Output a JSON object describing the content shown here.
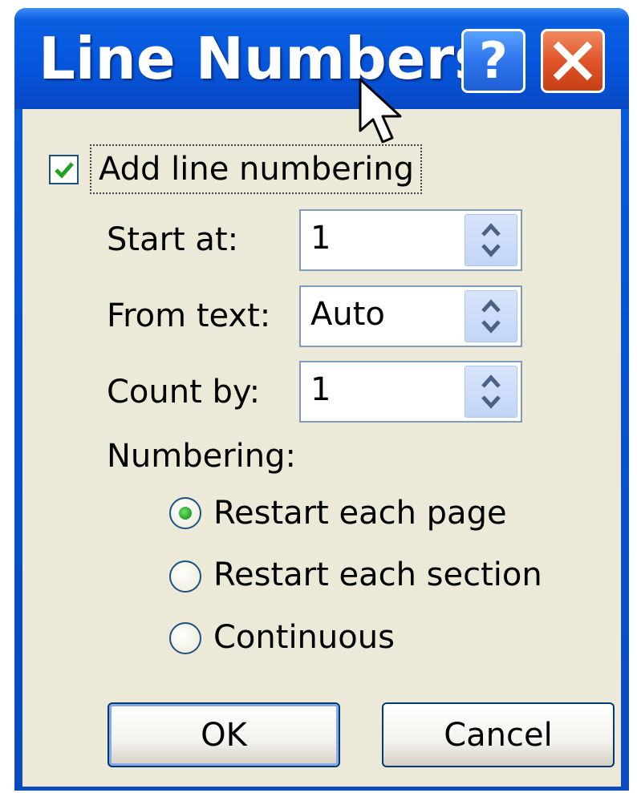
{
  "dialog": {
    "title": "Line Numbers",
    "help_button": "?",
    "close_icon": "close-icon"
  },
  "add_line_numbering": {
    "label": "Add line numbering",
    "checked": true
  },
  "fields": {
    "start_at": {
      "label": "Start at:",
      "value": "1"
    },
    "from_text": {
      "label": "From text:",
      "value": "Auto"
    },
    "count_by": {
      "label": "Count by:",
      "value": "1"
    }
  },
  "numbering": {
    "label": "Numbering:",
    "options": [
      {
        "label": "Restart each page",
        "selected": true
      },
      {
        "label": "Restart each section",
        "selected": false
      },
      {
        "label": "Continuous",
        "selected": false
      }
    ]
  },
  "buttons": {
    "ok": "OK",
    "cancel": "Cancel"
  },
  "colors": {
    "titlebar": "#0556dc",
    "client_bg": "#ece9d8",
    "close_button": "#e0552a",
    "help_button": "#2d75ec",
    "check_green": "#21a121"
  }
}
